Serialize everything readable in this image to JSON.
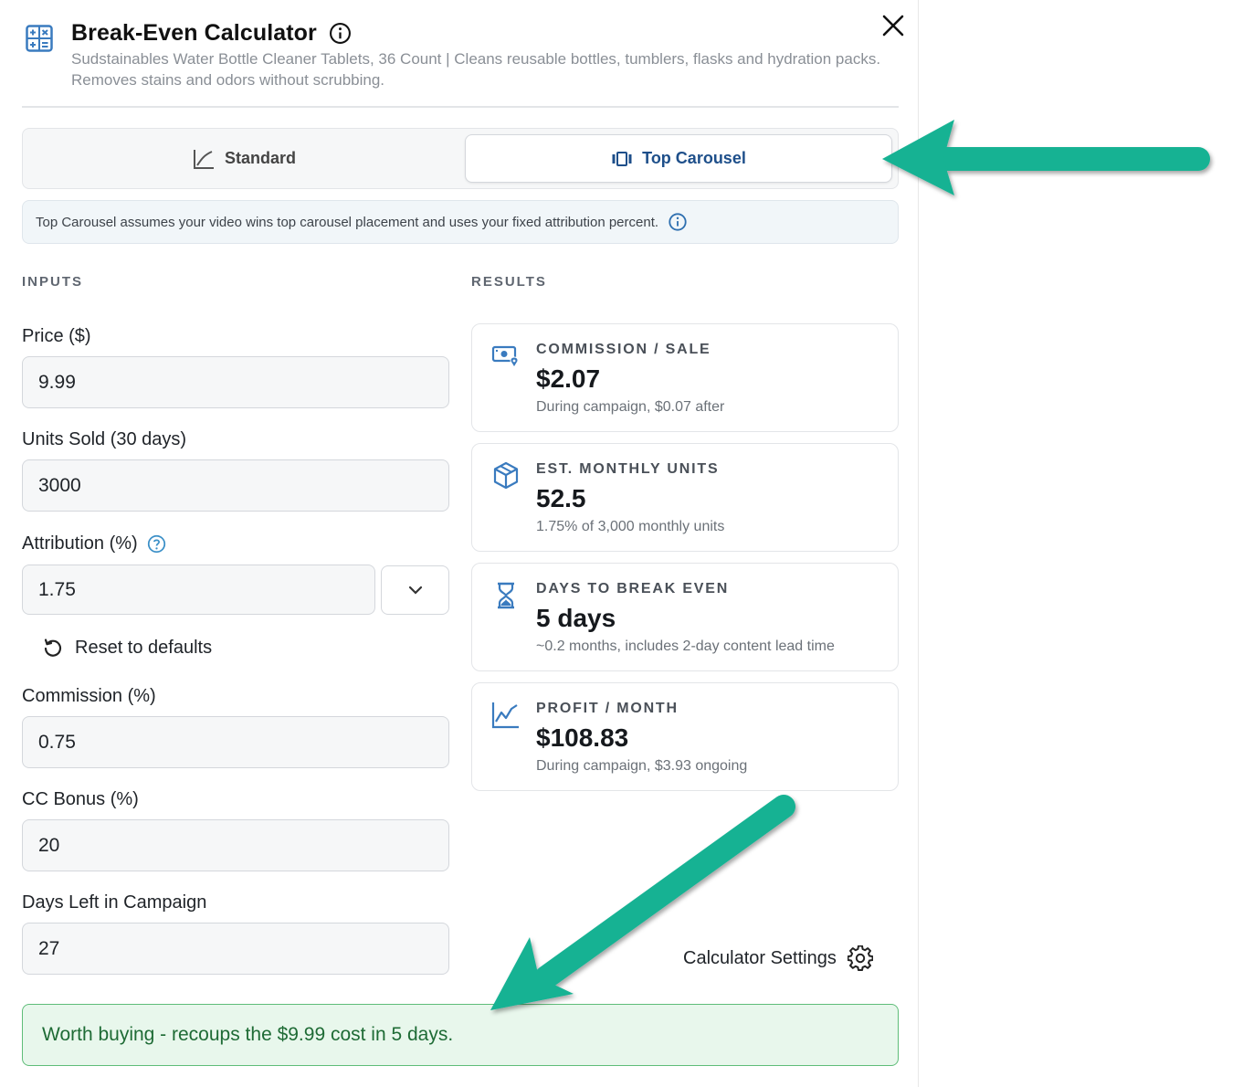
{
  "header": {
    "title": "Break-Even Calculator",
    "subtitle": "Sudstainables Water Bottle Cleaner Tablets, 36 Count | Cleans reusable bottles, tumblers, flasks and hydration packs. Removes stains and odors without scrubbing."
  },
  "tabs": {
    "standard_label": "Standard",
    "carousel_label": "Top Carousel",
    "active": "Top Carousel"
  },
  "notice": "Top Carousel assumes your video wins top carousel placement and uses your fixed attribution percent.",
  "sections": {
    "inputs": "INPUTS",
    "results": "RESULTS"
  },
  "inputs": {
    "price_label": "Price ($)",
    "price_value": "9.99",
    "units_label": "Units Sold (30 days)",
    "units_value": "3000",
    "attribution_label": "Attribution (%)",
    "attribution_value": "1.75",
    "reset_label": "Reset to defaults",
    "commission_label": "Commission (%)",
    "commission_value": "0.75",
    "cc_bonus_label": "CC Bonus (%)",
    "cc_bonus_value": "20",
    "days_left_label": "Days Left in Campaign",
    "days_left_value": "27"
  },
  "results": [
    {
      "icon": "money-icon",
      "label": "COMMISSION / SALE",
      "value": "$2.07",
      "sub": "During campaign, $0.07 after"
    },
    {
      "icon": "box-icon",
      "label": "EST. MONTHLY UNITS",
      "value": "52.5",
      "sub": "1.75% of 3,000 monthly units"
    },
    {
      "icon": "hourglass-icon",
      "label": "DAYS TO BREAK EVEN",
      "value": "5 days",
      "sub": "~0.2 months, includes 2-day content lead time"
    },
    {
      "icon": "chart-line-icon",
      "label": "PROFIT / MONTH",
      "value": "$108.83",
      "sub": "During campaign, $3.93 ongoing"
    }
  ],
  "settings_label": "Calculator Settings",
  "verdict": "Worth buying - recoups the $9.99 cost in 5 days.",
  "colors": {
    "accent": "#1e4f8a",
    "icon_blue": "#3a7bbf",
    "annotation_arrow": "#16b293",
    "success_bg": "#e8f7ec",
    "success_border": "#5fbd79",
    "success_text": "#1e6b35"
  }
}
